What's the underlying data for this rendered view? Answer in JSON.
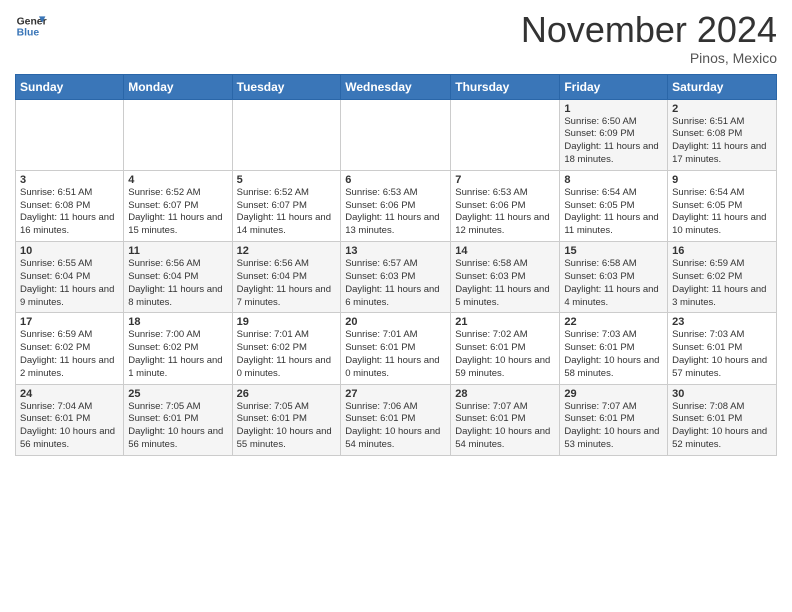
{
  "logo": {
    "line1": "General",
    "line2": "Blue"
  },
  "header": {
    "month": "November 2024",
    "location": "Pinos, Mexico"
  },
  "weekdays": [
    "Sunday",
    "Monday",
    "Tuesday",
    "Wednesday",
    "Thursday",
    "Friday",
    "Saturday"
  ],
  "weeks": [
    [
      {
        "day": "",
        "info": ""
      },
      {
        "day": "",
        "info": ""
      },
      {
        "day": "",
        "info": ""
      },
      {
        "day": "",
        "info": ""
      },
      {
        "day": "",
        "info": ""
      },
      {
        "day": "1",
        "info": "Sunrise: 6:50 AM\nSunset: 6:09 PM\nDaylight: 11 hours and 18 minutes."
      },
      {
        "day": "2",
        "info": "Sunrise: 6:51 AM\nSunset: 6:08 PM\nDaylight: 11 hours and 17 minutes."
      }
    ],
    [
      {
        "day": "3",
        "info": "Sunrise: 6:51 AM\nSunset: 6:08 PM\nDaylight: 11 hours and 16 minutes."
      },
      {
        "day": "4",
        "info": "Sunrise: 6:52 AM\nSunset: 6:07 PM\nDaylight: 11 hours and 15 minutes."
      },
      {
        "day": "5",
        "info": "Sunrise: 6:52 AM\nSunset: 6:07 PM\nDaylight: 11 hours and 14 minutes."
      },
      {
        "day": "6",
        "info": "Sunrise: 6:53 AM\nSunset: 6:06 PM\nDaylight: 11 hours and 13 minutes."
      },
      {
        "day": "7",
        "info": "Sunrise: 6:53 AM\nSunset: 6:06 PM\nDaylight: 11 hours and 12 minutes."
      },
      {
        "day": "8",
        "info": "Sunrise: 6:54 AM\nSunset: 6:05 PM\nDaylight: 11 hours and 11 minutes."
      },
      {
        "day": "9",
        "info": "Sunrise: 6:54 AM\nSunset: 6:05 PM\nDaylight: 11 hours and 10 minutes."
      }
    ],
    [
      {
        "day": "10",
        "info": "Sunrise: 6:55 AM\nSunset: 6:04 PM\nDaylight: 11 hours and 9 minutes."
      },
      {
        "day": "11",
        "info": "Sunrise: 6:56 AM\nSunset: 6:04 PM\nDaylight: 11 hours and 8 minutes."
      },
      {
        "day": "12",
        "info": "Sunrise: 6:56 AM\nSunset: 6:04 PM\nDaylight: 11 hours and 7 minutes."
      },
      {
        "day": "13",
        "info": "Sunrise: 6:57 AM\nSunset: 6:03 PM\nDaylight: 11 hours and 6 minutes."
      },
      {
        "day": "14",
        "info": "Sunrise: 6:58 AM\nSunset: 6:03 PM\nDaylight: 11 hours and 5 minutes."
      },
      {
        "day": "15",
        "info": "Sunrise: 6:58 AM\nSunset: 6:03 PM\nDaylight: 11 hours and 4 minutes."
      },
      {
        "day": "16",
        "info": "Sunrise: 6:59 AM\nSunset: 6:02 PM\nDaylight: 11 hours and 3 minutes."
      }
    ],
    [
      {
        "day": "17",
        "info": "Sunrise: 6:59 AM\nSunset: 6:02 PM\nDaylight: 11 hours and 2 minutes."
      },
      {
        "day": "18",
        "info": "Sunrise: 7:00 AM\nSunset: 6:02 PM\nDaylight: 11 hours and 1 minute."
      },
      {
        "day": "19",
        "info": "Sunrise: 7:01 AM\nSunset: 6:02 PM\nDaylight: 11 hours and 0 minutes."
      },
      {
        "day": "20",
        "info": "Sunrise: 7:01 AM\nSunset: 6:01 PM\nDaylight: 11 hours and 0 minutes."
      },
      {
        "day": "21",
        "info": "Sunrise: 7:02 AM\nSunset: 6:01 PM\nDaylight: 10 hours and 59 minutes."
      },
      {
        "day": "22",
        "info": "Sunrise: 7:03 AM\nSunset: 6:01 PM\nDaylight: 10 hours and 58 minutes."
      },
      {
        "day": "23",
        "info": "Sunrise: 7:03 AM\nSunset: 6:01 PM\nDaylight: 10 hours and 57 minutes."
      }
    ],
    [
      {
        "day": "24",
        "info": "Sunrise: 7:04 AM\nSunset: 6:01 PM\nDaylight: 10 hours and 56 minutes."
      },
      {
        "day": "25",
        "info": "Sunrise: 7:05 AM\nSunset: 6:01 PM\nDaylight: 10 hours and 56 minutes."
      },
      {
        "day": "26",
        "info": "Sunrise: 7:05 AM\nSunset: 6:01 PM\nDaylight: 10 hours and 55 minutes."
      },
      {
        "day": "27",
        "info": "Sunrise: 7:06 AM\nSunset: 6:01 PM\nDaylight: 10 hours and 54 minutes."
      },
      {
        "day": "28",
        "info": "Sunrise: 7:07 AM\nSunset: 6:01 PM\nDaylight: 10 hours and 54 minutes."
      },
      {
        "day": "29",
        "info": "Sunrise: 7:07 AM\nSunset: 6:01 PM\nDaylight: 10 hours and 53 minutes."
      },
      {
        "day": "30",
        "info": "Sunrise: 7:08 AM\nSunset: 6:01 PM\nDaylight: 10 hours and 52 minutes."
      }
    ]
  ]
}
